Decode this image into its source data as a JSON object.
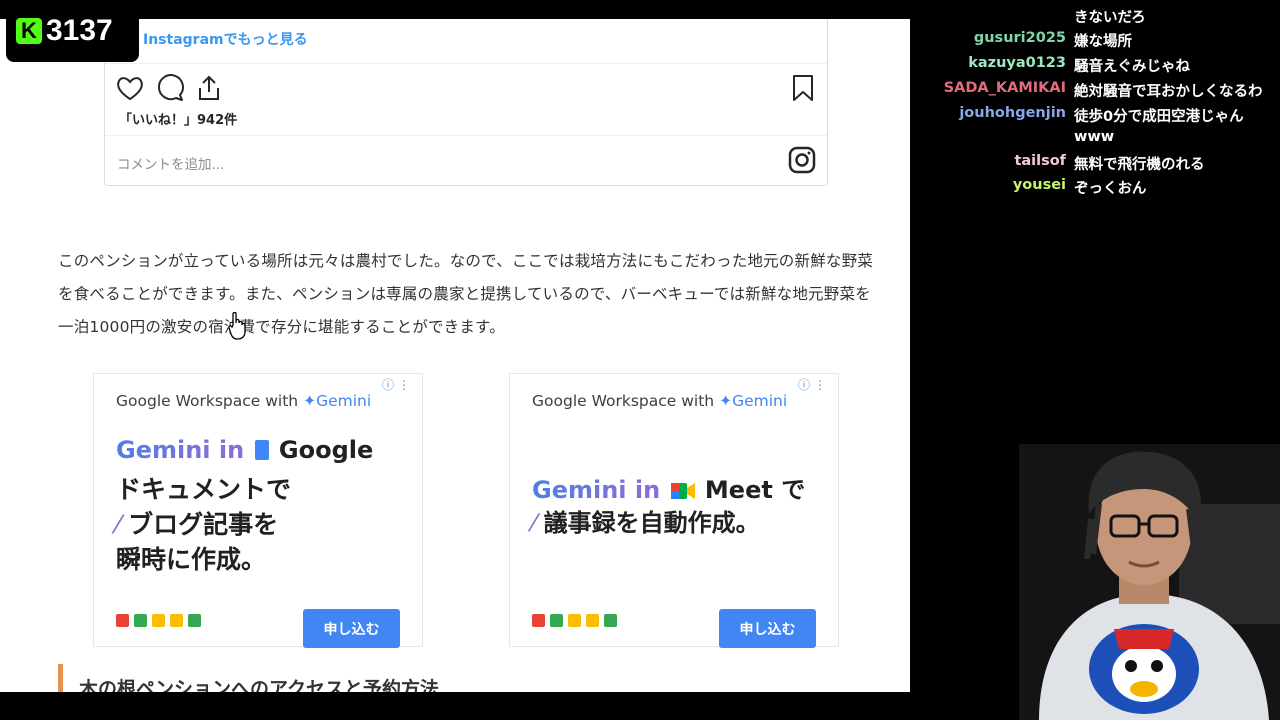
{
  "stream": {
    "viewer_count": "3137",
    "platform_logo": "K"
  },
  "instagram": {
    "more_link": "Instagramでもっと見る",
    "likes": "「いいね！」942件",
    "comment_placeholder": "コメントを追加...",
    "icons": [
      "heart-icon",
      "comment-icon",
      "share-icon",
      "bookmark-icon",
      "instagram-icon"
    ]
  },
  "article": {
    "paragraph": "このペンションが立っている場所は元々は農村でした。なので、ここでは栽培方法にもこだわった地元の新鮮な野菜を食べることができます。また、ペンションは専属の農家と提携しているので、バーベキューでは新鮮な地元野菜を一泊1000円の激安の宿泊費で存分に堪能することができます。",
    "next_heading": "木の根ペンションへのアクセスと予約方法"
  },
  "ads": [
    {
      "brand_prefix": "Google Workspace with",
      "brand_gemini": "Gemini",
      "title_gemini": "Gemini in",
      "title_product": "Google",
      "body_line1": "ドキュメントで",
      "body_line2": "ブログ記事を",
      "body_line3": "瞬時に作成。",
      "cta": "申し込む"
    },
    {
      "brand_prefix": "Google Workspace with",
      "brand_gemini": "Gemini",
      "title_gemini": "Gemini in",
      "title_product": "Meet で",
      "body_line1": "議事録を自動作成。",
      "cta": "申し込む"
    }
  ],
  "chat": [
    {
      "user": "",
      "message": "きないだろ",
      "color": "#ffffff"
    },
    {
      "user": "gusuri2025",
      "message": "嫌な場所",
      "color": "#7fd6a8"
    },
    {
      "user": "kazuya0123",
      "message": "騒音えぐみじゃね",
      "color": "#9ee7c0"
    },
    {
      "user": "SADA_KAMIKAI",
      "message": "絶対騒音で耳おかしくなるわ",
      "color": "#e26b7d"
    },
    {
      "user": "jouhohgenjin",
      "message": "徒歩0分で成田空港じゃん",
      "color": "#8aa6e8"
    },
    {
      "user": "",
      "message": "www",
      "color": "#ffffff"
    },
    {
      "user": "tailsof",
      "message": "無料で飛行機のれる",
      "color": "#f4c9de"
    },
    {
      "user": "yousei",
      "message": "ぞっくおん",
      "color": "#c6f56b"
    }
  ],
  "colors": {
    "kick_green": "#53fc18",
    "instagram_link": "#3897f0",
    "ad_button": "#4285f4",
    "section_accent": "#e8914d"
  }
}
